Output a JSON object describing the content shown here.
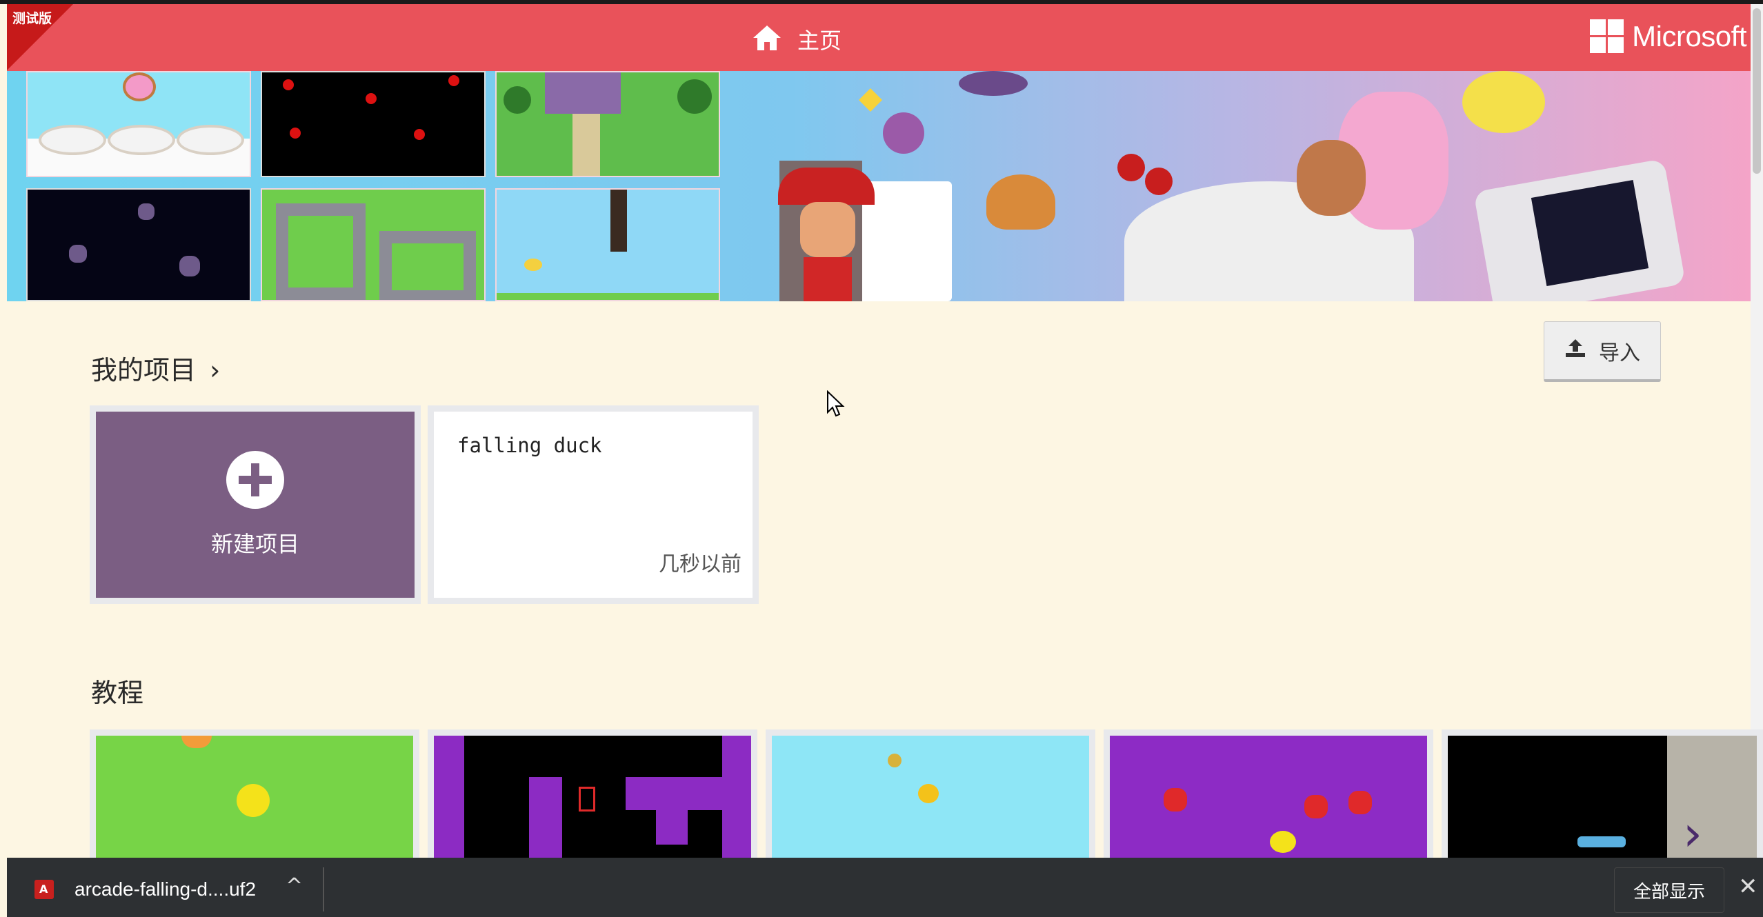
{
  "header": {
    "beta_label": "测试版",
    "home_label": "主页",
    "brand": "Microsoft",
    "bg_color": "#e9525a"
  },
  "my_projects": {
    "title": "我的项目",
    "import_label": "导入",
    "new_project_label": "新建项目",
    "projects": [
      {
        "name": "falling duck",
        "time": "几秒以前"
      }
    ]
  },
  "tutorials": {
    "title": "教程"
  },
  "download_bar": {
    "file_name": "arcade-falling-d....uf2",
    "show_all_label": "全部显示"
  }
}
